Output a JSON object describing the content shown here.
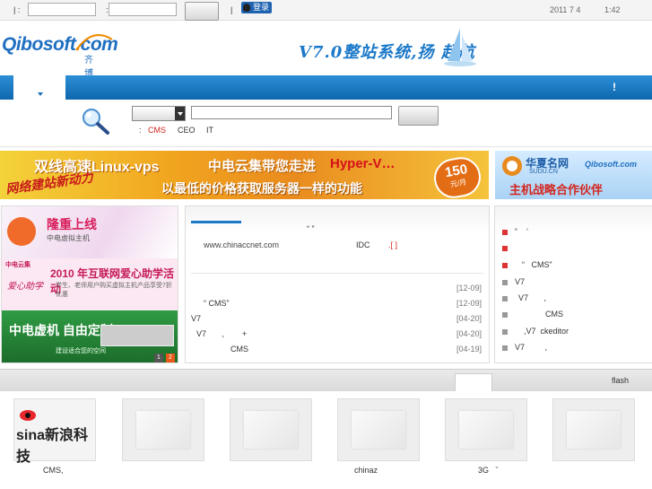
{
  "topbar": {
    "sep1": "|  :",
    "sep2": ":",
    "sep3": "|",
    "login": "登录",
    "date": "2011 7 4",
    "time": "1:42"
  },
  "header": {
    "logo_main": "Qibosoft",
    "logo_dot": ".",
    "logo_com": "com",
    "logo_sub": "齐博软件",
    "slogan": "V7.0整站系统,扬 起航"
  },
  "nav": {
    "alert": "!"
  },
  "search": {
    "hot_label": ":",
    "kw1": "CMS",
    "kw2": "CEO",
    "kw3": "IT"
  },
  "banner_main": {
    "line1": "双线高速Linux-vps",
    "line1b": "中电云集带您走进",
    "hyper": "Hyper-V…",
    "line2": "网络建站新动力",
    "line3": "以最低的价格获取服务器一样的功能",
    "price": "150",
    "price_unit": "元/月"
  },
  "banner_right": {
    "brand": "华夏名网",
    "brand_sub": "SUDU.CN",
    "partner_logo": "Qibosoft.com",
    "text": "主机战略合作伙伴"
  },
  "ads": [
    {
      "title": "隆重上线",
      "sub": "中电虚拟主机"
    },
    {
      "title": "2010 年互联网爱心助学活动",
      "sub": "学生、老师用户购买虚拟主机产品享受7折优惠",
      "brand": "中电云集",
      "side": "爱心助学"
    },
    {
      "title": "中电虚机 自由定制",
      "sub": "建设适合您的空间"
    }
  ],
  "ad_pager": [
    "1",
    "2"
  ],
  "news": {
    "headline_q": "“     ”",
    "link": "www.chinaccnet.com",
    "idc": "IDC",
    "more": ".[ ]",
    "items": [
      {
        "text": "",
        "date": "[12-09]"
      },
      {
        "text": "“   CMS”",
        "date": "[12-09]"
      },
      {
        "text": "V7",
        "date": "[04-20]"
      },
      {
        "text": "V7       ,        +",
        "date": "[04-20]"
      },
      {
        "text": "CMS",
        "date": "[04-19]"
      }
    ]
  },
  "notices": [
    "“    ‘",
    "",
    "“   CMS”",
    "V7",
    "V7       ,",
    "CMS",
    ",V7  ckeditor",
    "V7         ,"
  ],
  "bottom": {
    "tab": "flash",
    "sina": "sina新浪科技",
    "cap1": "CMS,",
    "cap2": "chinaz",
    "cap3": "3G   ˇ"
  },
  "colors": {
    "nav_blue": "#1b78c8",
    "logo_blue": "#1f6fc1",
    "logo_orange": "#f08a00",
    "hot_red": "#d3261e"
  }
}
